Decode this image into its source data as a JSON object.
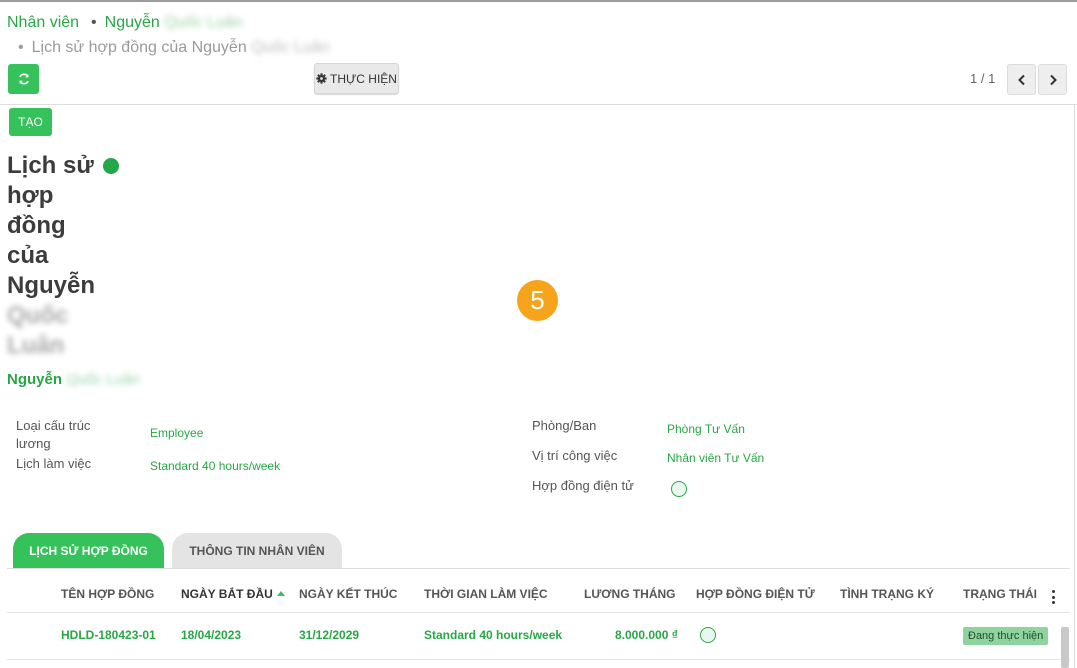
{
  "breadcrumb": {
    "root": "Nhân viên",
    "separator": "•",
    "employee_prefix": "Nguyễn",
    "employee_rest": "Quốc Luân",
    "current_prefix": "Lịch sử hợp đồng của Nguyễn",
    "current_rest": "Quốc Luân"
  },
  "toolbar": {
    "action_label": "THỰC HIỆN",
    "pager": "1 / 1",
    "create_label": "TẠO"
  },
  "record": {
    "title_lines": [
      "Lịch sử",
      "hợp",
      "đồng",
      "của",
      "Nguyễn"
    ],
    "title_blur_lines": [
      "Quốc",
      "Luân"
    ],
    "employee_prefix": "Nguyễn",
    "employee_rest": "Quốc Luân",
    "step_number": "5"
  },
  "fields": {
    "structure_label": "Loại cấu trúc lương",
    "structure_value": "Employee",
    "schedule_label": "Lịch làm việc",
    "schedule_value": "Standard 40 hours/week",
    "department_label": "Phòng/Ban",
    "department_value": "Phòng Tư Vấn",
    "position_label": "Vị trí công việc",
    "position_value": "Nhân viên Tư Vấn",
    "econtract_label": "Hợp đồng điện tử"
  },
  "tabs": [
    "LỊCH SỬ HỢP ĐỒNG",
    "THÔNG TIN NHÂN VIÊN"
  ],
  "table": {
    "columns": [
      "TÊN HỢP ĐỒNG",
      "NGÀY BẮT ĐẦU",
      "NGÀY KẾT THÚC",
      "THỜI GIAN LÀM VIỆC",
      "LƯƠNG THÁNG",
      "HỢP ĐỒNG ĐIỆN TỬ",
      "TÌNH TRẠNG KÝ",
      "TRẠNG THÁI"
    ],
    "rows": [
      {
        "name": "HDLD-180423-01",
        "start": "18/04/2023",
        "end": "31/12/2029",
        "schedule": "Standard 40 hours/week",
        "salary": "8.000.000 ₫",
        "sign_status": "",
        "status": "Đang thực hiện"
      }
    ]
  },
  "colors": {
    "accent": "#35c25b",
    "link": "#28a745",
    "step_badge": "#f7a41d"
  },
  "icons": {
    "refresh": "refresh-icon",
    "action": "gear-icon",
    "prev": "chevron-left-icon",
    "next": "chevron-right-icon"
  }
}
